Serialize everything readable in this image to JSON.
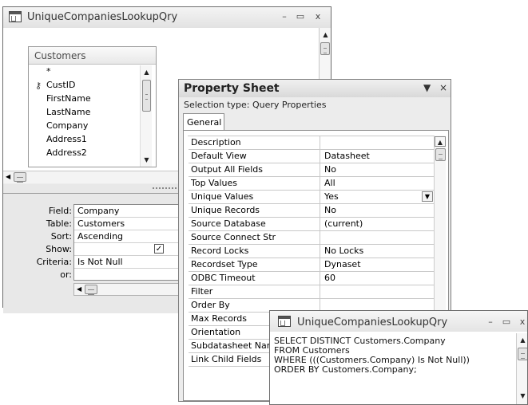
{
  "query_window": {
    "title": "UniqueCompaniesLookupQry",
    "minimize": "–",
    "maximize": "▭",
    "close": "x"
  },
  "field_list": {
    "table_name": "Customers",
    "fields": [
      "*",
      "CustID",
      "FirstName",
      "LastName",
      "Company",
      "Address1",
      "Address2"
    ],
    "primary_key": "CustID"
  },
  "design_grid": {
    "row_labels": {
      "field": "Field:",
      "table": "Table:",
      "sort": "Sort:",
      "show": "Show:",
      "criteria": "Criteria:",
      "or": "or:"
    },
    "column": {
      "field": "Company",
      "table": "Customers",
      "sort": "Ascending",
      "show": true,
      "criteria": "Is Not Null",
      "or": ""
    }
  },
  "property_sheet": {
    "title": "Property Sheet",
    "selection_type": "Selection type:  Query Properties",
    "tab": "General",
    "properties": [
      {
        "name": "Description",
        "value": ""
      },
      {
        "name": "Default View",
        "value": "Datasheet"
      },
      {
        "name": "Output All Fields",
        "value": "No"
      },
      {
        "name": "Top Values",
        "value": "All"
      },
      {
        "name": "Unique Values",
        "value": "Yes"
      },
      {
        "name": "Unique Records",
        "value": "No"
      },
      {
        "name": "Source Database",
        "value": "(current)"
      },
      {
        "name": "Source Connect Str",
        "value": ""
      },
      {
        "name": "Record Locks",
        "value": "No Locks"
      },
      {
        "name": "Recordset Type",
        "value": "Dynaset"
      },
      {
        "name": "ODBC Timeout",
        "value": "60"
      },
      {
        "name": "Filter",
        "value": ""
      },
      {
        "name": "Order By",
        "value": ""
      },
      {
        "name": "Max Records",
        "value": ""
      },
      {
        "name": "Orientation",
        "value": ""
      },
      {
        "name": "Subdatasheet Nam",
        "value": ""
      },
      {
        "name": "Link Child Fields",
        "value": ""
      }
    ]
  },
  "sql_window": {
    "title": "UniqueCompaniesLookupQry",
    "minimize": "–",
    "maximize": "▭",
    "close": "x",
    "lines": [
      "SELECT DISTINCT Customers.Company",
      "FROM Customers",
      "WHERE (((Customers.Company) Is Not Null))",
      "ORDER BY Customers.Company;"
    ]
  }
}
